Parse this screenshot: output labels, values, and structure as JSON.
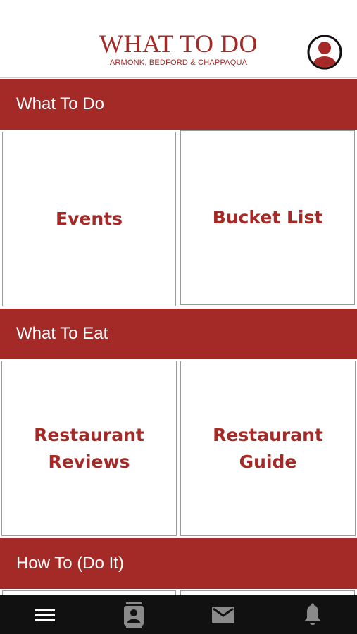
{
  "header": {
    "title": "WHAT TO DO",
    "subtitle": "ARMONK, BEDFORD & CHAPPAQUA",
    "profile_icon": "user-circle-icon"
  },
  "sections": [
    {
      "label": "What To Do",
      "tiles": [
        {
          "label": "Events"
        },
        {
          "label": "Bucket List"
        }
      ]
    },
    {
      "label": "What To Eat",
      "tiles": [
        {
          "label": "Restaurant\nReviews"
        },
        {
          "label": "Restaurant\nGuide"
        }
      ]
    },
    {
      "label": "How To (Do It)",
      "tiles": []
    }
  ],
  "tabbar": {
    "items": [
      {
        "icon": "menu-icon"
      },
      {
        "icon": "contacts-icon"
      },
      {
        "icon": "mail-icon"
      },
      {
        "icon": "bell-icon"
      }
    ]
  },
  "colors": {
    "brand": "#a42a27",
    "tabbar": "#111111",
    "tabbar_active": "#ffffff",
    "tabbar_inactive": "#8a8a8a"
  }
}
